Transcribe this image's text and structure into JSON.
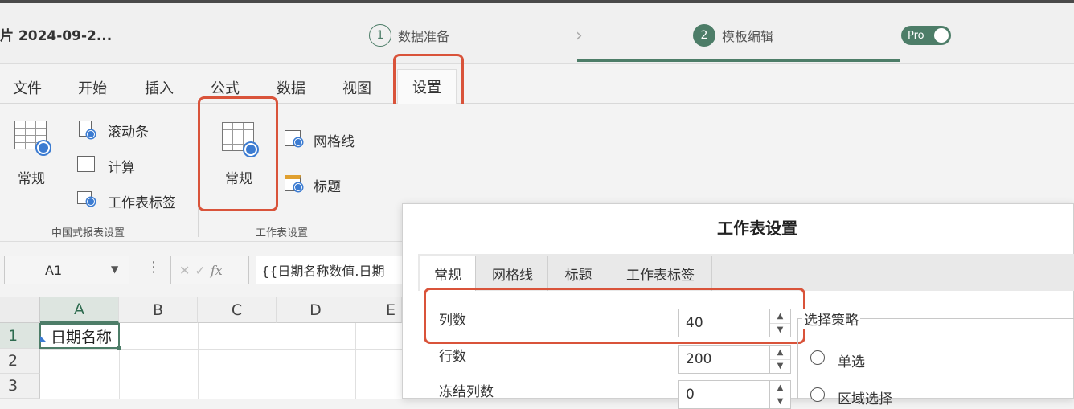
{
  "titlebar": {
    "doc_title": "片 2024-09-2...",
    "steps": [
      {
        "num": "1",
        "label": "数据准备",
        "active": false
      },
      {
        "num": "2",
        "label": "模板编辑",
        "active": true
      }
    ],
    "chevron": "›",
    "pro_label": "Pro"
  },
  "menubar": {
    "items": [
      "文件",
      "开始",
      "插入",
      "公式",
      "数据",
      "视图",
      "设置"
    ],
    "active_index": 6
  },
  "ribbon": {
    "group1": {
      "big_button": "常规",
      "items": [
        "滚动条",
        "计算",
        "工作表标签"
      ],
      "label": "中国式报表设置"
    },
    "group2": {
      "big_button": "常规",
      "items": [
        "网格线",
        "标题"
      ],
      "label": "工作表设置"
    }
  },
  "formula_bar": {
    "name_box": "A1",
    "cancel": "✕",
    "confirm": "✓",
    "fx": "fx",
    "formula": "{{日期名称数值.日期"
  },
  "sheet": {
    "columns": [
      "A",
      "B",
      "C",
      "D",
      "E"
    ],
    "rows": [
      "1",
      "2",
      "3"
    ],
    "active_cell_text": "日期名称"
  },
  "dialog": {
    "title": "工作表设置",
    "tabs": [
      "常规",
      "网格线",
      "标题",
      "工作表标签"
    ],
    "fields": [
      {
        "label": "列数",
        "value": "40"
      },
      {
        "label": "行数",
        "value": "200"
      },
      {
        "label": "冻结列数",
        "value": "0"
      }
    ],
    "selection_group": {
      "legend": "选择策略",
      "options": [
        "单选",
        "区域选择"
      ]
    }
  },
  "colors": {
    "accent": "#4d7d68",
    "highlight": "#d9533a",
    "gear": "#3b7bd1"
  }
}
